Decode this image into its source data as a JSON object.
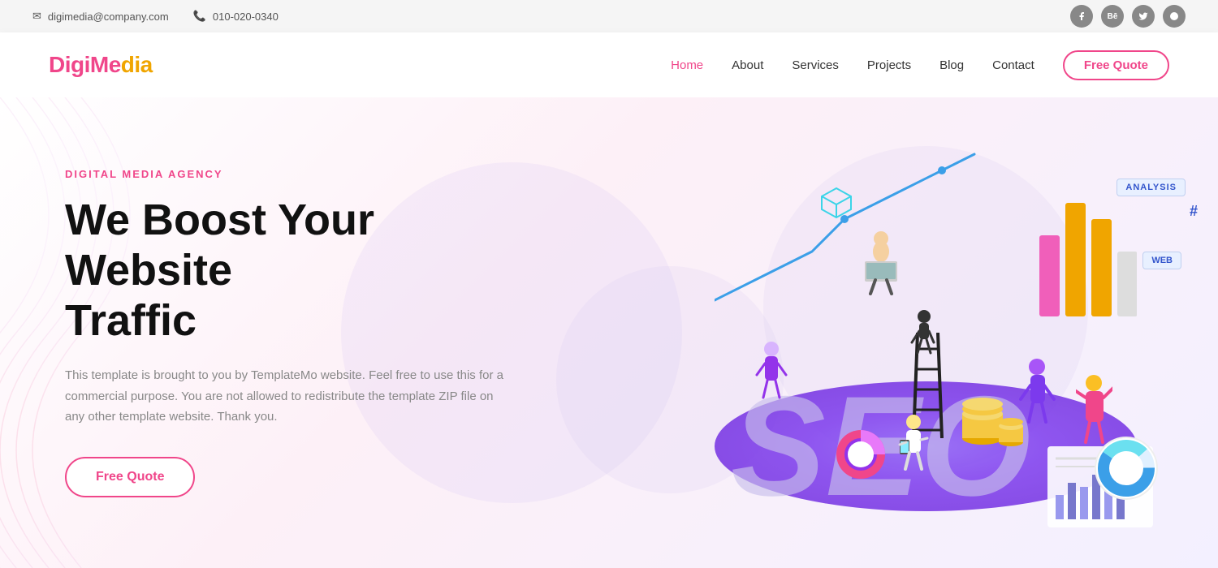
{
  "topbar": {
    "email_icon": "✉",
    "email": "digimedia@company.com",
    "phone_icon": "📞",
    "phone": "010-020-0340"
  },
  "social": [
    {
      "name": "facebook",
      "icon": "f",
      "label": "Facebook"
    },
    {
      "name": "behance",
      "icon": "B",
      "label": "Behance"
    },
    {
      "name": "twitter",
      "icon": "t",
      "label": "Twitter"
    },
    {
      "name": "dribbble",
      "icon": "◉",
      "label": "Dribbble"
    }
  ],
  "header": {
    "logo_part1": "DigiMe",
    "logo_part2": "di",
    "logo_full": "DigiMedia",
    "nav": [
      {
        "label": "Home",
        "active": true
      },
      {
        "label": "About",
        "active": false
      },
      {
        "label": "Services",
        "active": false
      },
      {
        "label": "Projects",
        "active": false
      },
      {
        "label": "Blog",
        "active": false
      },
      {
        "label": "Contact",
        "active": false
      }
    ],
    "cta_label": "Free Quote"
  },
  "hero": {
    "subtitle": "DIGITAL MEDIA AGENCY",
    "title_line1": "We Boost Your Website",
    "title_line2": "Traffic",
    "description": "This template is brought to you by TemplateMo website. Feel free to use this for a commercial purpose. You are not allowed to redistribute the template ZIP file on any other template website. Thank you.",
    "cta_label": "Free Quote"
  },
  "illustration": {
    "seo_text": "SEO",
    "label_analysis": "ANALYSIS",
    "label_web": "WEB",
    "label_hash": "#"
  },
  "colors": {
    "pink": "#f0468a",
    "orange": "#f0a500",
    "purple": "#7c3aed",
    "blue": "#3b9fe8"
  }
}
